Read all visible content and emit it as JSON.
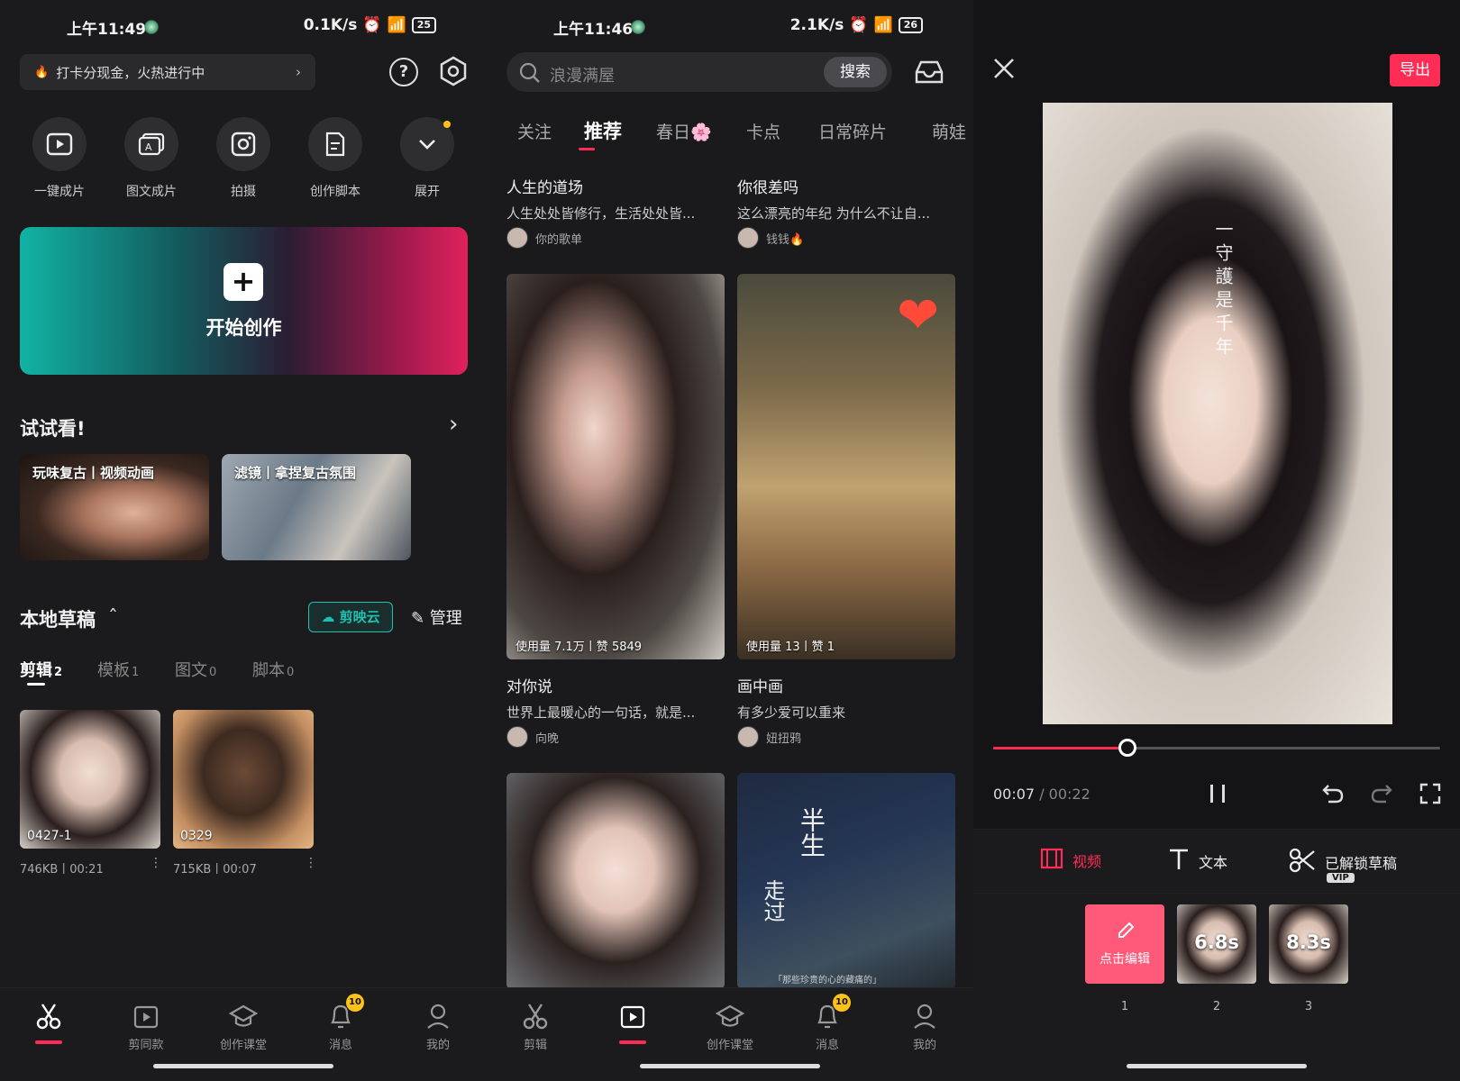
{
  "panel_home": {
    "status": {
      "time": "上午11:49",
      "speed": "0.1K/s",
      "battery": "25"
    },
    "promo": {
      "text": "打卡分现金，火热进行中",
      "chevron": "›"
    },
    "help_icon": "?",
    "quick_actions": [
      {
        "icon": "play-square-icon",
        "label": "一键成片"
      },
      {
        "icon": "image-text-icon",
        "label": "图文成片"
      },
      {
        "icon": "camera-icon",
        "label": "拍摄"
      },
      {
        "icon": "script-doc-icon",
        "label": "创作脚本"
      },
      {
        "icon": "chevron-down-icon",
        "label": "展开"
      }
    ],
    "start_create": {
      "plus": "+",
      "label": "开始创作"
    },
    "try_section": {
      "title": "试试看!",
      "chevron": "›",
      "cards": [
        {
          "caption": "玩味复古丨视频动画"
        },
        {
          "caption": "滤镜丨拿捏复古氛围"
        }
      ]
    },
    "drafts": {
      "title": "本地草稿",
      "collapse": "ˆ",
      "cloud_button": "☁ 剪映云",
      "manage": "✎ 管理",
      "tabs": [
        {
          "label": "剪辑",
          "count": "2"
        },
        {
          "label": "模板",
          "count": "1"
        },
        {
          "label": "图文",
          "count": "0"
        },
        {
          "label": "脚本",
          "count": "0"
        }
      ],
      "items": [
        {
          "name": "0427-1",
          "meta": "746KB丨00:21"
        },
        {
          "name": "0329",
          "meta": "715KB丨00:07"
        }
      ],
      "more": "⋮"
    },
    "nav": [
      {
        "label": "",
        "icon": "scissors-icon",
        "active": true
      },
      {
        "label": "剪同款",
        "icon": "template-play-icon"
      },
      {
        "label": "创作课堂",
        "icon": "graduation-cap-icon"
      },
      {
        "label": "消息",
        "icon": "bell-icon",
        "badge": "10"
      },
      {
        "label": "我的",
        "icon": "person-icon"
      }
    ]
  },
  "panel_templates": {
    "status": {
      "time": "上午11:46",
      "speed": "2.1K/s",
      "battery": "26"
    },
    "search": {
      "placeholder": "浪漫满屋",
      "button": "搜索"
    },
    "tabs": [
      "关注",
      "推荐",
      "春日🌸",
      "卡点",
      "日常碎片",
      "萌娃"
    ],
    "active_tab": "推荐",
    "top_items": [
      {
        "title": "人生的道场",
        "desc": "人生处处皆修行，生活处处皆...",
        "author": "你的歌单"
      },
      {
        "title": "你很差吗",
        "desc": "这么漂亮的年纪 为什么不让自...",
        "author": "钱钱🔥"
      }
    ],
    "cards": [
      {
        "stats": "使用量 7.1万丨赞 5849",
        "title": "对你说",
        "desc": "世界上最暖心的一句话，就是...",
        "author": "向晚"
      },
      {
        "stats": "使用量 13丨赞 1",
        "title": "画中画",
        "desc": "有多少爱可以重来",
        "author": "妞扭鸦"
      }
    ],
    "poem_large": "半生",
    "poem_small": "走过",
    "poem_footer": "「那些珍贵的心的藏痛的」",
    "heart": "❤",
    "nav": [
      {
        "label": "剪辑",
        "icon": "scissors-icon"
      },
      {
        "label": "",
        "icon": "template-play-icon",
        "active": true
      },
      {
        "label": "创作课堂",
        "icon": "graduation-cap-icon"
      },
      {
        "label": "消息",
        "icon": "bell-icon",
        "badge": "10"
      },
      {
        "label": "我的",
        "icon": "person-icon"
      }
    ]
  },
  "panel_editor": {
    "export_label": "导出",
    "overlay_text": "一守護是千年",
    "progress": 0.3,
    "time_current": "00:07",
    "time_sep": " / ",
    "time_total": "00:22",
    "tools": [
      {
        "icon": "film-icon",
        "label": "视频",
        "active": true
      },
      {
        "icon": "text-t-icon",
        "label": "文本"
      },
      {
        "icon": "scissors-icon",
        "label": "已解锁草稿"
      }
    ],
    "vip_badge": "VIP",
    "clips": [
      {
        "kind": "edit",
        "label": "点击编辑",
        "num": "1"
      },
      {
        "kind": "face",
        "label": "6.8s",
        "num": "2"
      },
      {
        "kind": "face",
        "label": "8.3s",
        "num": "3"
      }
    ]
  },
  "colors": {
    "accent": "#ff2c55",
    "teal": "#1ec1b0",
    "badge": "#ffc21a"
  }
}
